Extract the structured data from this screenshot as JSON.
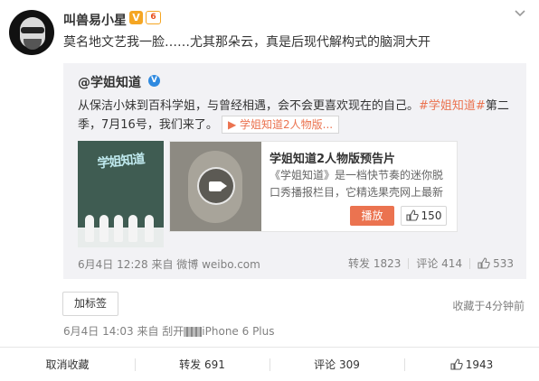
{
  "post": {
    "username": "叫兽易小星",
    "vip_badge": "V",
    "level_badge": "6",
    "text": "莫名地文艺我一脸……尤其那朵云，真是后现代解构式的脑洞大开"
  },
  "repost": {
    "author": "@学姐知道",
    "verified_badge": "V",
    "text_main": "从保洁小妹到百科学姐，与曾经相遇，会不会更喜欢现在的自己。",
    "hashtag": "#学姐知道#",
    "text_after": "第二季，7月16号，我们来了。",
    "video_link": "学姐知道2人物版...",
    "poster_title": "学姐知道",
    "video_card": {
      "title": "学姐知道2人物版预告片",
      "description": "《学姐知道》是一档快节奏的迷你脱口秀播报栏目，它精选果壳网上最新",
      "play_button": "播放",
      "like_count": "150"
    },
    "meta": "6月4日 12:28 来自 微博 weibo.com",
    "repost_label": "转发 1823",
    "comment_label": "评论 414",
    "like_count": "533"
  },
  "tag_button": "加标签",
  "favorited_time": "收藏于4分钟前",
  "post_meta_prefix": "6月4日 14:03 来自 刮开",
  "post_meta_suffix": "iPhone 6 Plus",
  "actions": {
    "cancel_fav": "取消收藏",
    "repost": "转发 691",
    "comment": "评论 309",
    "like": "1943"
  },
  "colors": {
    "accent": "#eb7350",
    "badge_orange": "#f5a623",
    "verified_blue": "#2f8ae0"
  }
}
